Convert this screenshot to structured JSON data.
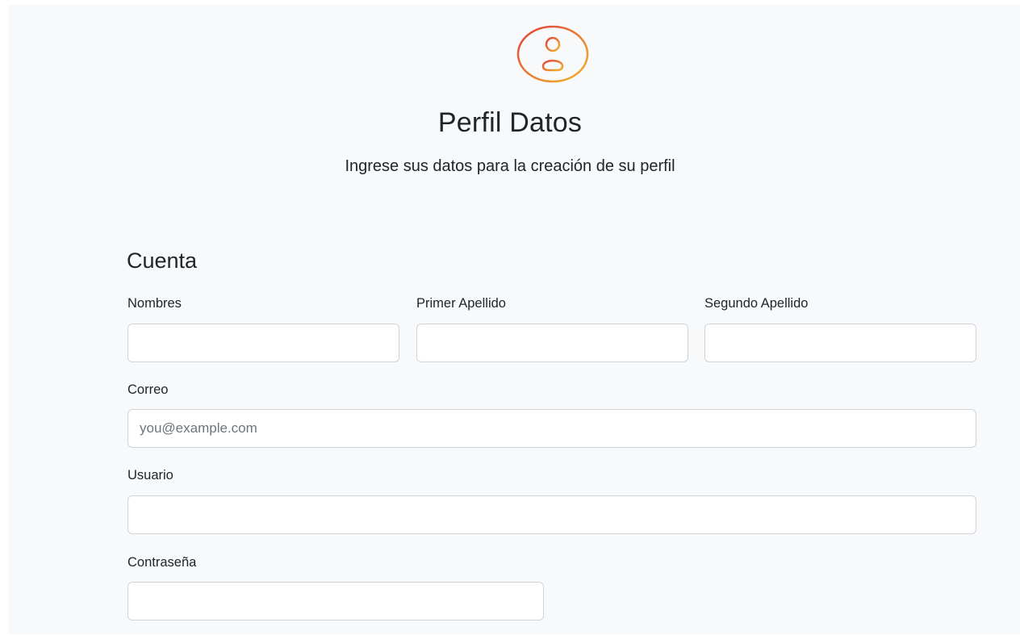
{
  "header": {
    "logo_icon": "user-circle-icon",
    "title": "Perfil Datos",
    "subtitle": "Ingrese sus datos para la creación de su perfil"
  },
  "form": {
    "section_title": "Cuenta",
    "fields": {
      "nombres": {
        "label": "Nombres",
        "value": "",
        "placeholder": ""
      },
      "primer_apellido": {
        "label": "Primer Apellido",
        "value": "",
        "placeholder": ""
      },
      "segundo_apellido": {
        "label": "Segundo Apellido",
        "value": "",
        "placeholder": ""
      },
      "correo": {
        "label": "Correo",
        "value": "",
        "placeholder": "you@example.com"
      },
      "usuario": {
        "label": "Usuario",
        "value": "",
        "placeholder": ""
      },
      "contrasena": {
        "label": "Contraseña",
        "value": "",
        "placeholder": ""
      }
    }
  },
  "colors": {
    "gradient_start": "#e0403c",
    "gradient_end": "#f2b52a",
    "panel_bg": "#f8f9fa",
    "input_border": "#ced4da"
  }
}
